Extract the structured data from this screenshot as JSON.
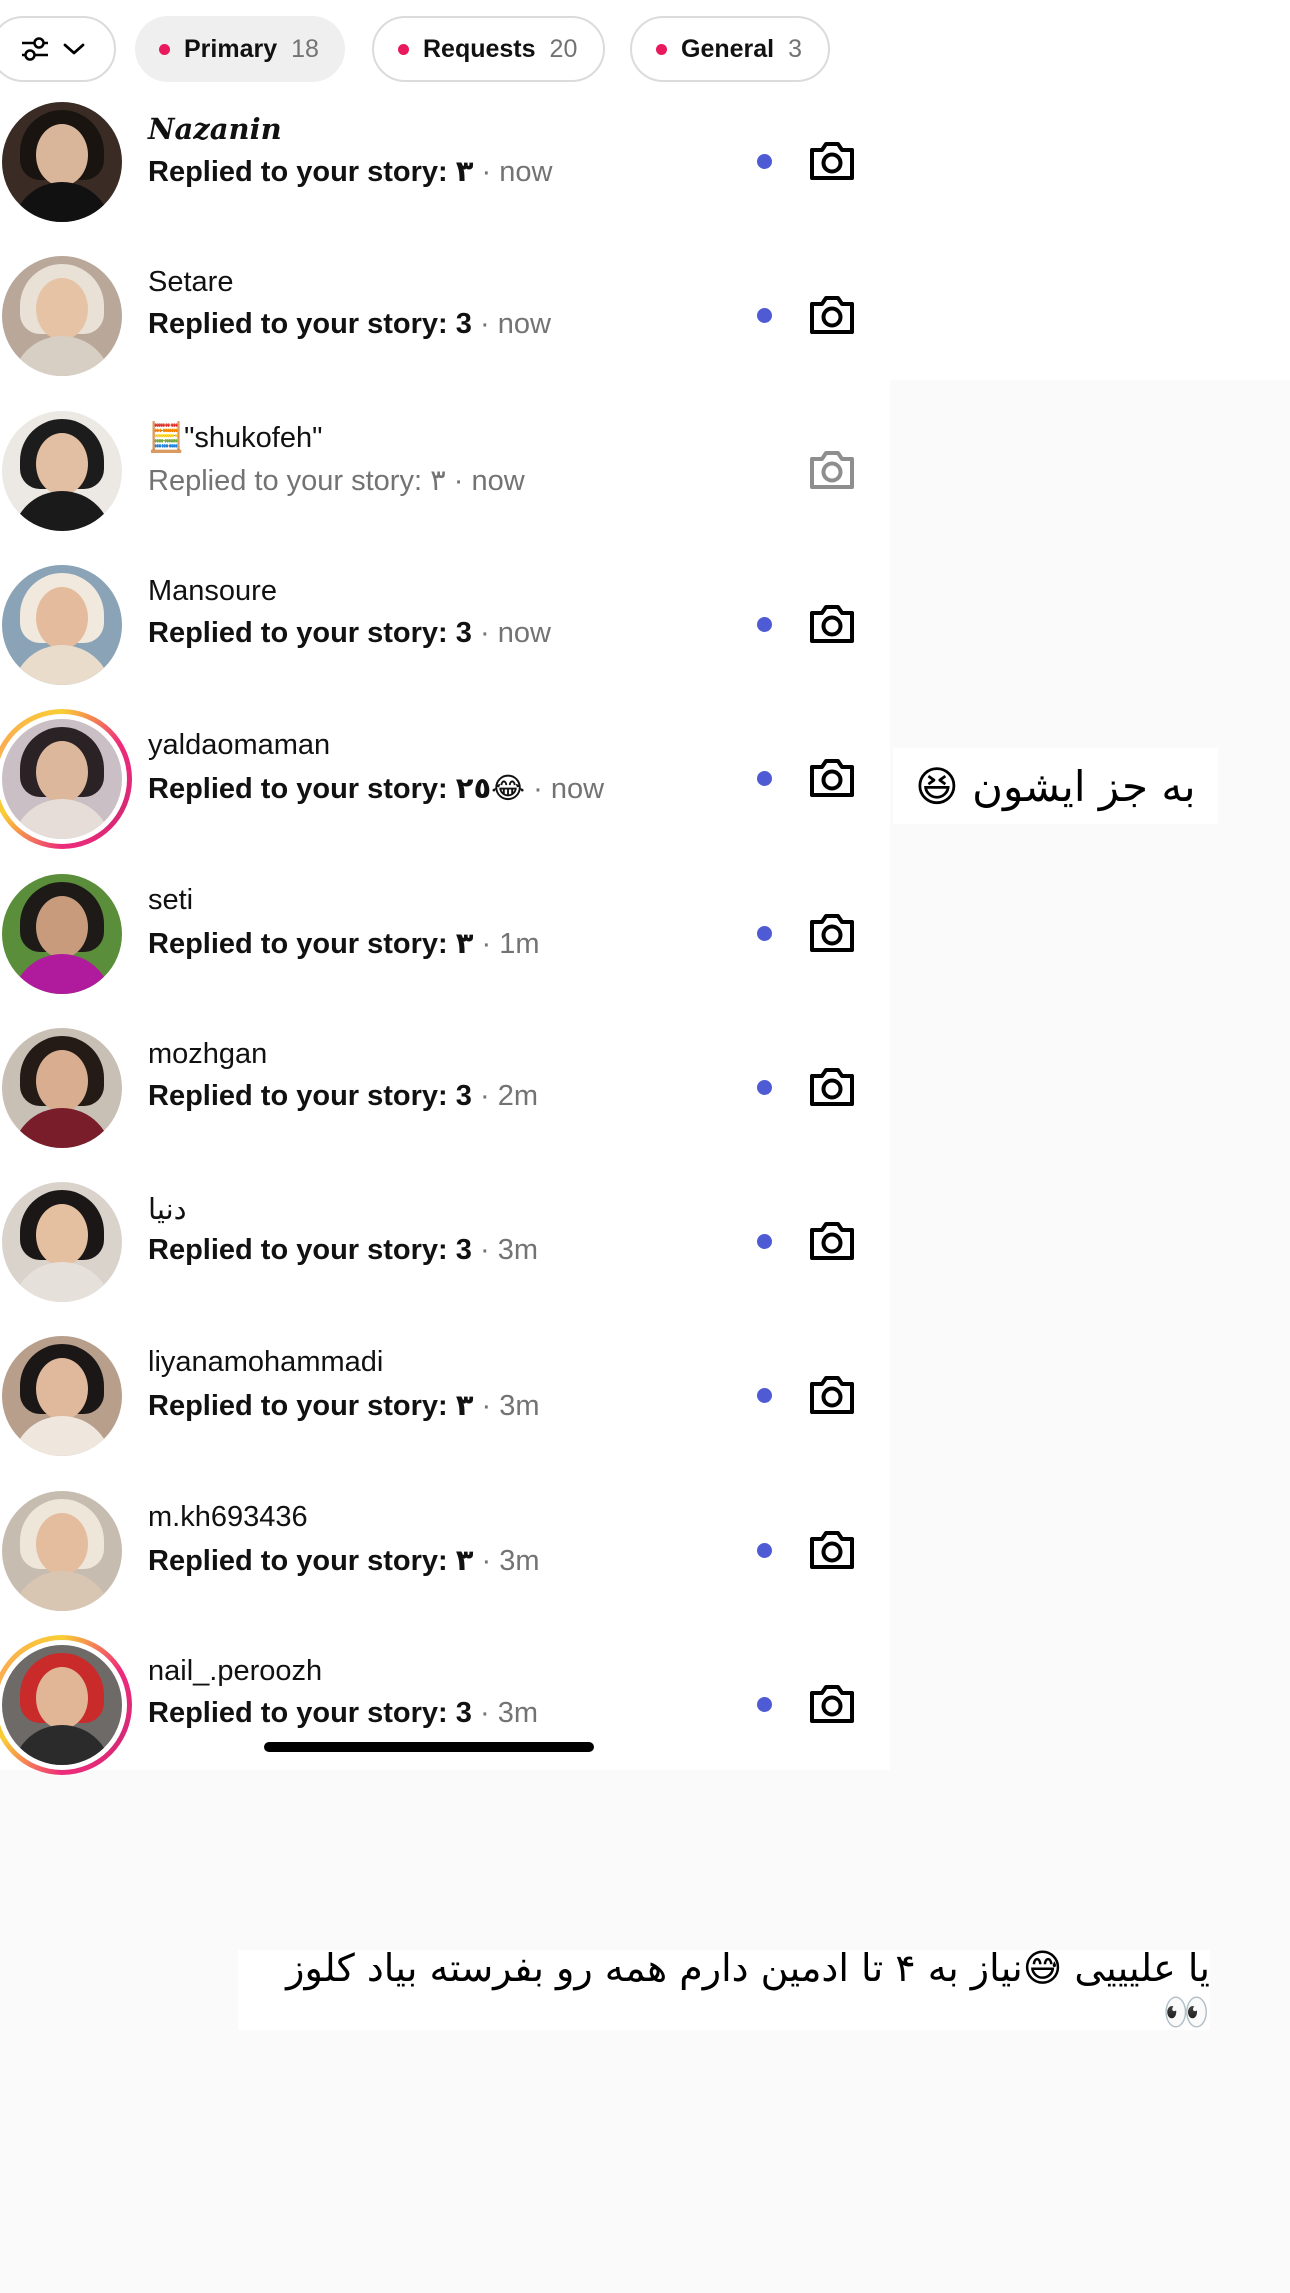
{
  "tabs": [
    {
      "label": "Primary",
      "count": "18"
    },
    {
      "label": "Requests",
      "count": "20"
    },
    {
      "label": "General",
      "count": "3"
    }
  ],
  "threads": [
    {
      "name": "Nazanin",
      "message": "Replied to your story: ٣",
      "time": "now",
      "unread": true
    },
    {
      "name": "Setare",
      "message": "Replied to your story: 3",
      "time": "now",
      "unread": true
    },
    {
      "name": "🧮\"shukofeh\"",
      "message": "Replied to your story: ٣",
      "time": "now",
      "unread": false
    },
    {
      "name": "Mansoure",
      "message": "Replied to your story: 3",
      "time": "now",
      "unread": true
    },
    {
      "name": "yaldaomaman",
      "message": "Replied to your story: ٢٥😂",
      "time": "now",
      "unread": true
    },
    {
      "name": "seti",
      "message": "Replied to your story: ٣",
      "time": "1m",
      "unread": true
    },
    {
      "name": "mozhgan",
      "message": "Replied to your story: 3",
      "time": "2m",
      "unread": true
    },
    {
      "name": "دنیا",
      "message": "Replied to your story: 3",
      "time": "3m",
      "unread": true
    },
    {
      "name": "liyanamohammadi",
      "message": "Replied to your story: ٣",
      "time": "3m",
      "unread": true
    },
    {
      "name": "m.kh693436",
      "message": "Replied to your story: ٣",
      "time": "3m",
      "unread": true
    },
    {
      "name": "nail_.peroozh",
      "message": "Replied to your story: 3",
      "time": "3m",
      "unread": true
    }
  ],
  "separator": "·",
  "overlays": {
    "sticker_1": "به جز ایشون 😆",
    "sticker_2": "یا علیییی 😅نیاز به ۴ تا ادمین دارم همه رو بفرسته بیاد کلوز 👀"
  },
  "colors": {
    "unread_dot": "#4f5bd5",
    "tab_dot": "#e8195c",
    "secondary_text": "#737373"
  }
}
